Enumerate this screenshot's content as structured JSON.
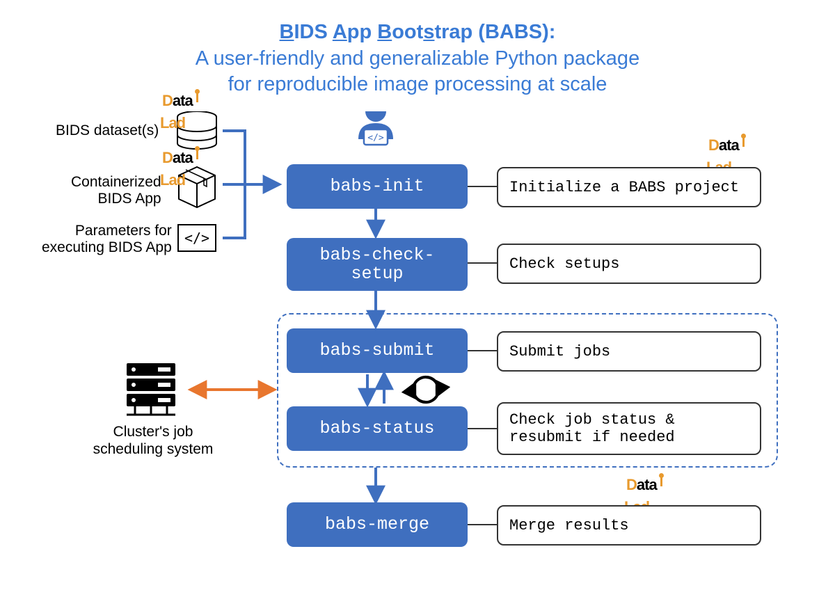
{
  "title": {
    "line1_u1": "B",
    "line1_p1": "IDS ",
    "line1_u2": "A",
    "line1_p2": "pp ",
    "line1_u3": "B",
    "line1_p3": "oot",
    "line1_u4": "s",
    "line1_p4": "trap (BABS):",
    "line2": "A user-friendly and generalizable Python package",
    "line3": "for reproducible image processing at scale"
  },
  "inputs": {
    "dataset": "BIDS dataset(s)",
    "container_l1": "Containerized",
    "container_l2": "BIDS App",
    "params_l1": "Parameters for",
    "params_l2": "executing BIDS App"
  },
  "commands": {
    "init": "babs-init",
    "check_l1": "babs-check-",
    "check_l2": "setup",
    "submit": "babs-submit",
    "status": "babs-status",
    "merge": "babs-merge"
  },
  "descriptions": {
    "init": "Initialize a BABS project",
    "check": "Check setups",
    "submit": "Submit jobs",
    "status_l1": "Check job status &",
    "status_l2": "resubmit if needed",
    "merge": "Merge results"
  },
  "cluster": {
    "l1": "Cluster's job",
    "l2": "scheduling system"
  },
  "logo": {
    "part1": "D",
    "part2": "ata",
    "part3": "Lad"
  }
}
